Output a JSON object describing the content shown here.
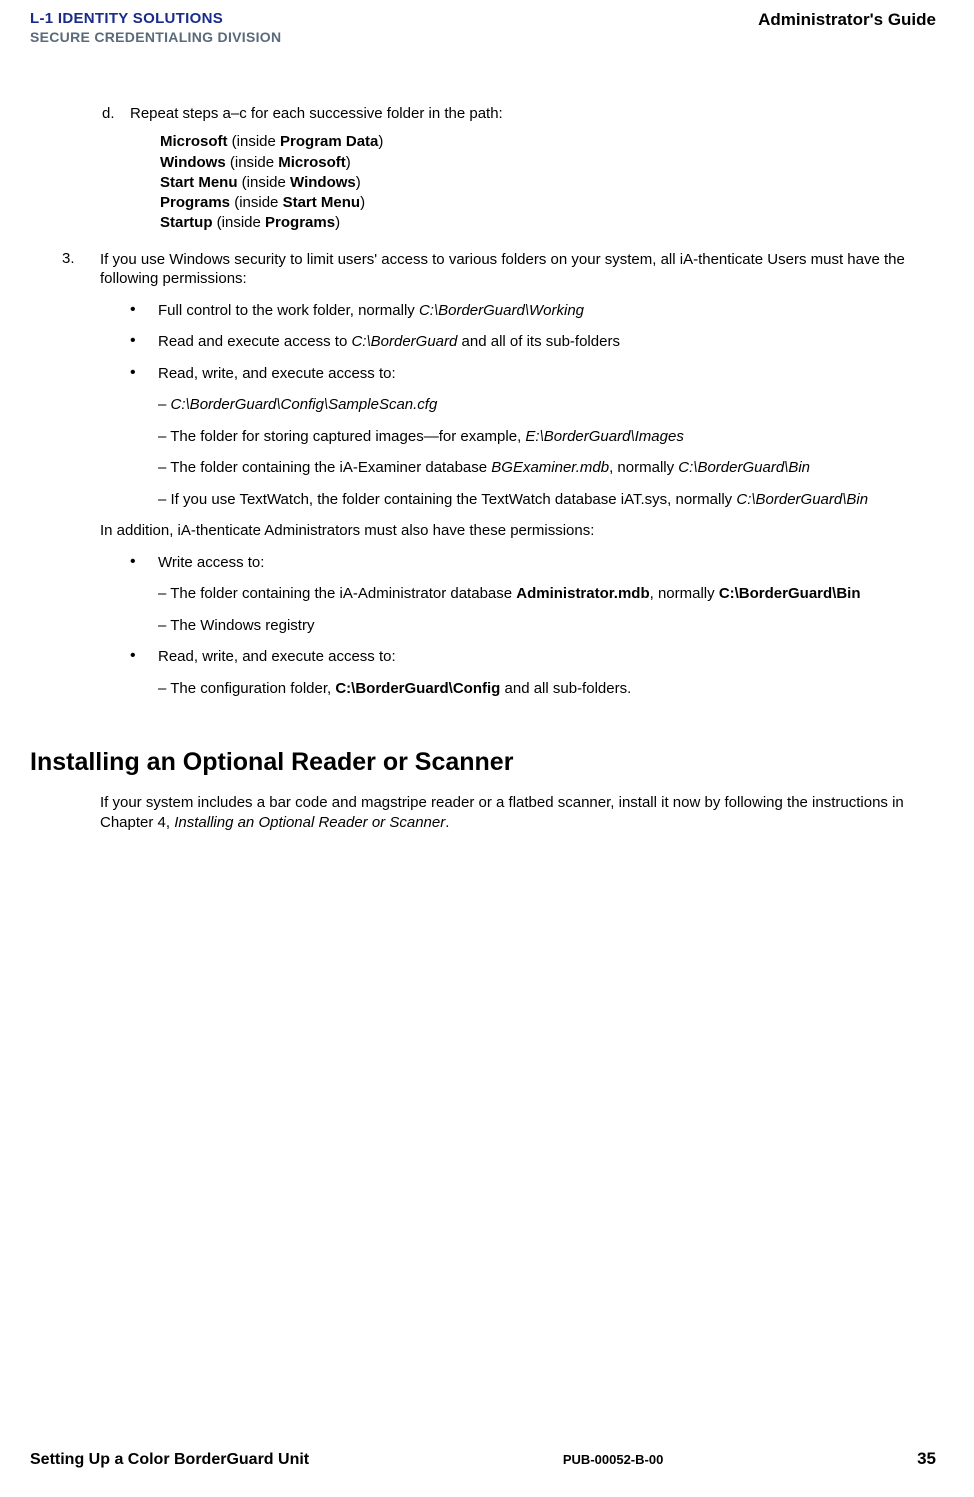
{
  "header": {
    "logo_line1_prefix": "L-1",
    "logo_line1_rest": " IDENTITY SOLUTIONS",
    "logo_line2": "SECURE CREDENTIALING DIVISION",
    "doc_title": "Administrator's Guide"
  },
  "step_d": {
    "marker": "d.",
    "text": "Repeat steps a–c for each successive folder in the path:"
  },
  "folders": {
    "f1a": "Microsoft",
    "f1b": " (inside ",
    "f1c": "Program Data",
    "f1d": ")",
    "f2a": "Windows",
    "f2b": " (inside ",
    "f2c": "Microsoft",
    "f2d": ")",
    "f3a": "Start Menu",
    "f3b": " (inside ",
    "f3c": "Windows",
    "f3d": ")",
    "f4a": "Programs",
    "f4b": " (inside ",
    "f4c": "Start Menu",
    "f4d": ")",
    "f5a": "Startup",
    "f5b": " (inside ",
    "f5c": "Programs",
    "f5d": ")"
  },
  "step_3": {
    "marker": "3.",
    "text": "If you use Windows security to limit users' access to various folders on your system, all iA-thenticate Users must have the following permissions:"
  },
  "bullets1": {
    "b1_pre": "Full control to the work folder, normally ",
    "b1_it": "C:\\BorderGuard\\Working",
    "b2_pre": "Read and execute access to ",
    "b2_it": "C:\\BorderGuard",
    "b2_post": " and all of its sub-folders",
    "b3": "Read, write, and execute access to:"
  },
  "dashes1": {
    "d1_pre": "– ",
    "d1_it": "C:\\BorderGuard\\Config\\SampleScan.cfg",
    "d2_pre": "– The folder for storing captured images—for example, ",
    "d2_it": "E:\\BorderGuard\\Images",
    "d3_pre": "– The folder containing the iA-Examiner database ",
    "d3_it1": "BGExaminer.mdb",
    "d3_mid": ", normally ",
    "d3_it2": "C:\\BorderGuard\\Bin",
    "d4_pre": "– If you use TextWatch, the folder containing the TextWatch database iAT.sys, normally ",
    "d4_it": "C:\\BorderGuard\\Bin"
  },
  "para_admin": "In addition, iA-thenticate Administrators must also have these permissions:",
  "bullets2": {
    "b1": "Write access to:",
    "b2": "Read, write, and execute access to:"
  },
  "dashes2": {
    "d1_pre": "– The folder containing the iA-Administrator database ",
    "d1_b1": "Administrator.mdb",
    "d1_mid": ", normally ",
    "d1_b2": "C:\\BorderGuard\\Bin",
    "d2": "– The Windows registry",
    "d3_pre": "– The configuration folder, ",
    "d3_b": "C:\\BorderGuard\\Config",
    "d3_post": " and all sub-folders."
  },
  "section": {
    "heading": "Installing an Optional Reader or Scanner",
    "para_pre": "If your system includes a bar code and magstripe reader or a flatbed scanner, install it now by following the instructions in Chapter 4, ",
    "para_it": "Installing an Optional Reader or Scanner",
    "para_post": "."
  },
  "footer": {
    "left": "Setting Up a Color BorderGuard Unit",
    "center": "PUB-00052-B-00",
    "right": "35"
  },
  "bullet_glyph": "•"
}
